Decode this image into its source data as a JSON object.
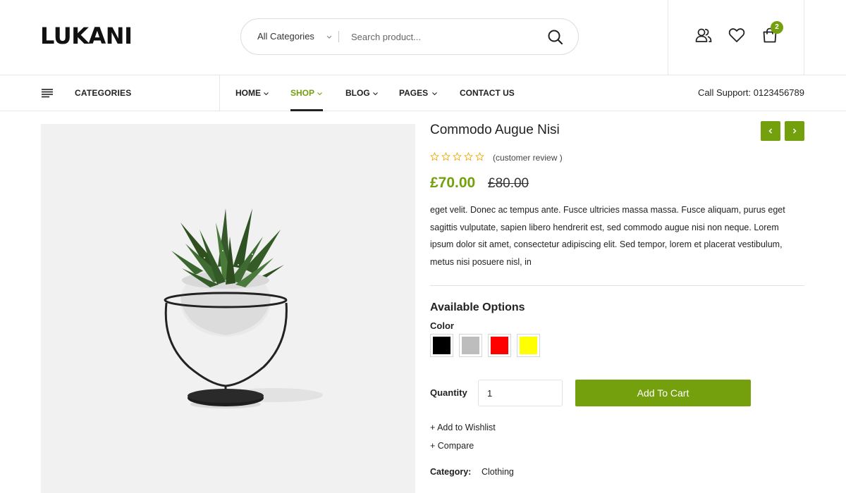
{
  "header": {
    "logo": "LUKANI",
    "search": {
      "category_label": "All Categories",
      "placeholder": "Search product...",
      "search_icon": "search-icon"
    },
    "tools": {
      "account_icon": "user-icon",
      "wishlist_icon": "heart-icon",
      "cart_icon": "shopping-bag-icon",
      "cart_count": "2"
    }
  },
  "nav": {
    "categories_label": "CATEGORIES",
    "items": [
      {
        "label": "HOME",
        "has_dropdown": true,
        "active": false
      },
      {
        "label": "SHOP",
        "has_dropdown": true,
        "active": true
      },
      {
        "label": "BLOG",
        "has_dropdown": true,
        "active": false
      },
      {
        "label": "PAGES",
        "has_dropdown": true,
        "active": false
      },
      {
        "label": "CONTACT US",
        "has_dropdown": false,
        "active": false
      }
    ],
    "support": "Call Support: 0123456789"
  },
  "product": {
    "title": "Commodo Augue Nisi",
    "rating": 0,
    "rating_max": 5,
    "review_text": "(customer review )",
    "price": "£70.00",
    "old_price": "£80.00",
    "description": "eget velit. Donec ac tempus ante. Fusce ultricies massa massa. Fusce aliquam, purus eget sagittis vulputate, sapien libero hendrerit est, sed commodo augue nisi non neque. Lorem ipsum dolor sit amet, consectetur adipiscing elit. Sed tempor, lorem et placerat vestibulum, metus nisi posuere nisl, in",
    "options_title": "Available Options",
    "color_label": "Color",
    "colors": [
      "#000000",
      "#bdbdbd",
      "#ff0000",
      "#ffff00"
    ],
    "quantity_label": "Quantity",
    "quantity": "1",
    "add_to_cart": "Add To Cart",
    "add_to_wishlist": "+ Add to Wishlist",
    "compare": "+ Compare",
    "category_label": "Category:",
    "category_value": "Clothing"
  },
  "colors": {
    "accent": "#75a00e",
    "text": "#222222",
    "border": "#e6e6e6",
    "image_bg": "#f1f1f1"
  }
}
